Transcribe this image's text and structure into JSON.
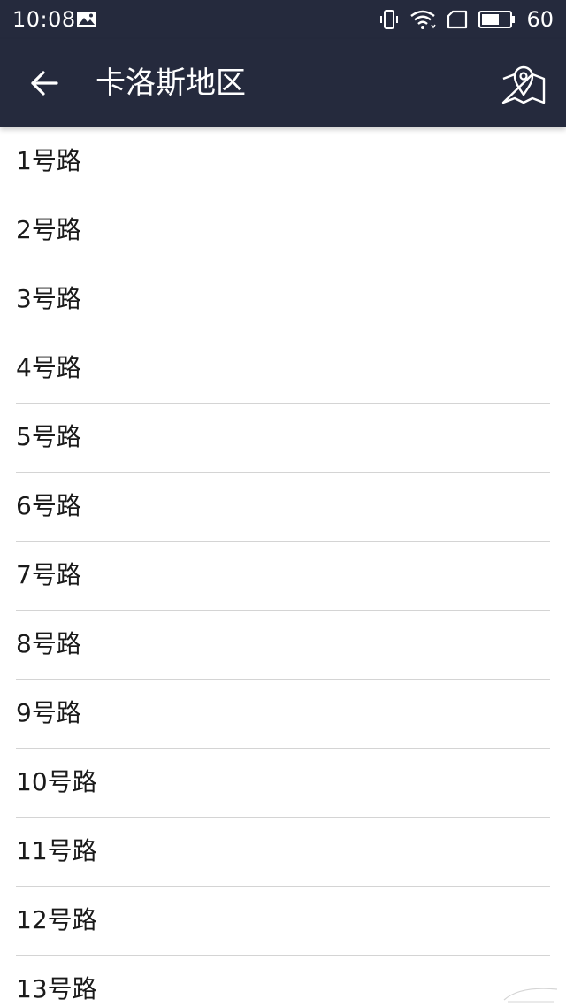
{
  "status_bar": {
    "time": "10:08",
    "battery_percent": "60",
    "icons": [
      "image-icon",
      "vibrate-icon",
      "wifi-icon",
      "sim-icon",
      "battery-icon"
    ]
  },
  "toolbar": {
    "title": "卡洛斯地区",
    "back_icon": "arrow-left-icon",
    "map_icon": "map-pin-icon"
  },
  "roads": [
    {
      "label": "1号路"
    },
    {
      "label": "2号路"
    },
    {
      "label": "3号路"
    },
    {
      "label": "4号路"
    },
    {
      "label": "5号路"
    },
    {
      "label": "6号路"
    },
    {
      "label": "7号路"
    },
    {
      "label": "8号路"
    },
    {
      "label": "9号路"
    },
    {
      "label": "10号路"
    },
    {
      "label": "11号路"
    },
    {
      "label": "12号路"
    },
    {
      "label": "13号路"
    }
  ],
  "colors": {
    "header_background": "#252a3d",
    "list_text": "#1a1a1a",
    "divider": "#d4d4d4",
    "background": "#ffffff"
  }
}
